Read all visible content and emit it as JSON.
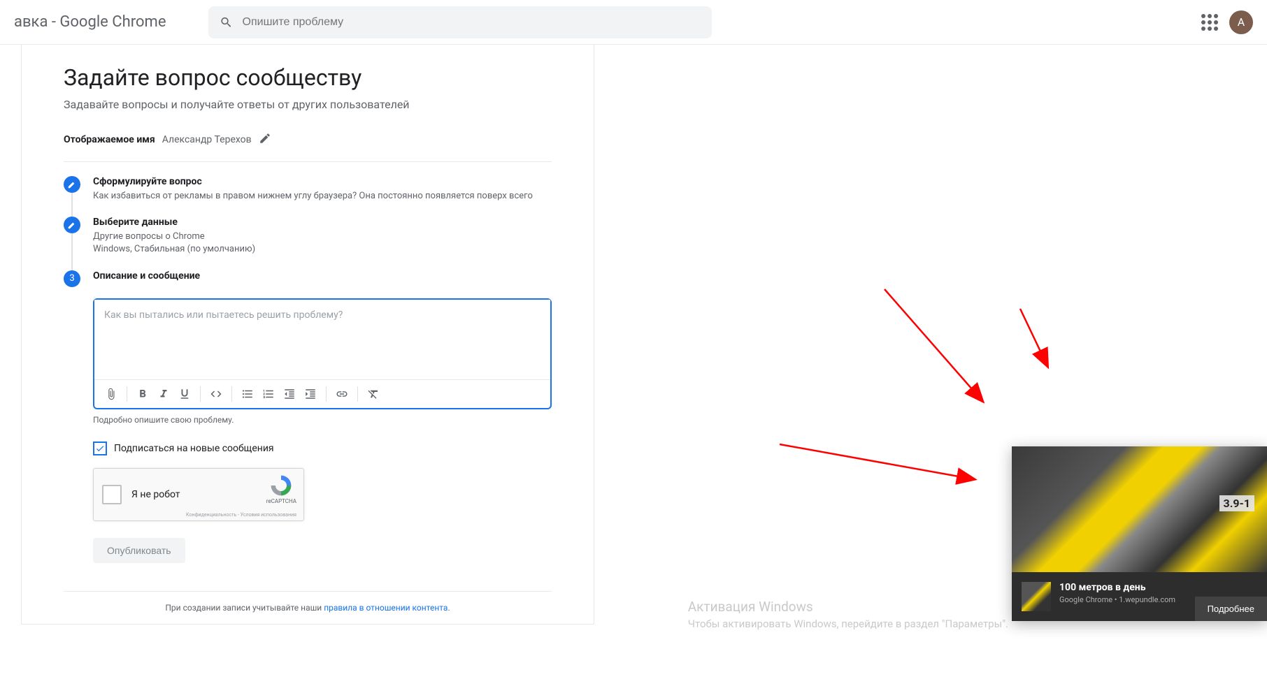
{
  "header": {
    "title": "авка - Google Chrome",
    "search_placeholder": "Опишите проблему",
    "avatar_letter": "А"
  },
  "main": {
    "heading": "Задайте вопрос сообществу",
    "subheading": "Задавайте вопросы и получайте ответы от других пользователей",
    "display_name_label": "Отображаемое имя",
    "display_name_value": "Александр Терехов"
  },
  "steps": {
    "s1": {
      "title": "Сформулируйте вопрос",
      "desc": "Как избавиться от рекламы в правом нижнем углу браузера? Она постоянно появляется поверх всего"
    },
    "s2": {
      "title": "Выберите данные",
      "desc1": "Другие вопросы о Chrome",
      "desc2": "Windows, Стабильная (по умолчанию)"
    },
    "s3": {
      "num": "3",
      "title": "Описание и сообщение"
    }
  },
  "editor": {
    "placeholder": "Как вы пытались или пытаетесь решить проблему?",
    "helper": "Подробно опишите свою проблему."
  },
  "subscribe": {
    "label": "Подписаться на новые сообщения"
  },
  "recaptcha": {
    "label": "Я не робот",
    "brand": "reCAPTCHA",
    "terms": "Конфиденциальность - Условия использования"
  },
  "publish_label": "Опубликовать",
  "footer": {
    "prefix": "При создании записи учитывайте наши ",
    "link": "правила в отношении контента",
    "suffix": "."
  },
  "notification": {
    "title": "100 метров в день",
    "source": "Google Chrome • 1.wepundle.com",
    "more": "Подробнее",
    "pipe": "3.9-1"
  },
  "watermark": {
    "title": "Активация Windows",
    "sub": "Чтобы активировать Windows, перейдите в раздел \"Параметры\"."
  }
}
